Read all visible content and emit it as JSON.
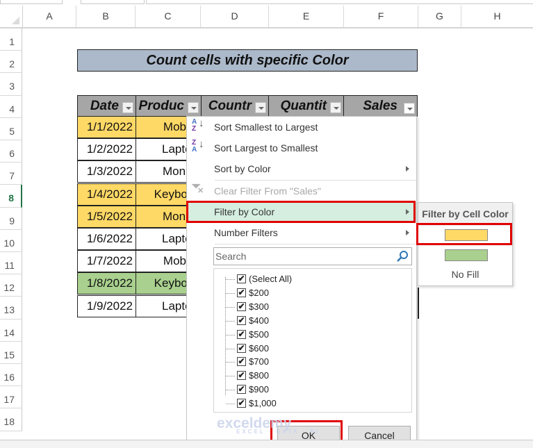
{
  "columns": [
    "A",
    "B",
    "C",
    "D",
    "E",
    "F",
    "G",
    "H"
  ],
  "rows": [
    "1",
    "2",
    "3",
    "4",
    "5",
    "6",
    "7",
    "8",
    "9",
    "10",
    "11",
    "12",
    "13",
    "14",
    "15",
    "16",
    "17",
    "18"
  ],
  "selected_row": "8",
  "sheet_title": "Count cells with specific Color",
  "table": {
    "headers": [
      "Date",
      "Produc",
      "Countr",
      "Quantit",
      "Sales"
    ],
    "rows": [
      {
        "date": "1/1/2022",
        "product": "Mobile",
        "fill": "#ffd966"
      },
      {
        "date": "1/2/2022",
        "product": "Laptop",
        "fill": "#ffffff"
      },
      {
        "date": "1/3/2022",
        "product": "Monito",
        "fill": "#ffffff"
      },
      {
        "date": "1/4/2022",
        "product": "Keyboar",
        "fill": "#ffd966"
      },
      {
        "date": "1/5/2022",
        "product": "Monito",
        "fill": "#ffd966"
      },
      {
        "date": "1/6/2022",
        "product": "Laptop",
        "fill": "#ffffff"
      },
      {
        "date": "1/7/2022",
        "product": "Mobile",
        "fill": "#ffffff"
      },
      {
        "date": "1/8/2022",
        "product": "Keyboar",
        "fill": "#a9d08e"
      },
      {
        "date": "1/9/2022",
        "product": "Laptop",
        "fill": "#ffffff"
      }
    ]
  },
  "filter_menu": {
    "items": [
      {
        "label": "Sort Smallest to Largest",
        "icon": "sort-ascending-icon",
        "enabled": true
      },
      {
        "label": "Sort Largest to Smallest",
        "icon": "sort-descending-icon",
        "enabled": true
      },
      {
        "label": "Sort by Color",
        "submenu": true,
        "enabled": true
      },
      {
        "label": "Clear Filter From \"Sales\"",
        "icon": "clear-filter-icon",
        "enabled": false
      },
      {
        "label": "Filter by Color",
        "submenu": true,
        "enabled": true,
        "highlighted": true
      },
      {
        "label": "Number Filters",
        "submenu": true,
        "enabled": true
      }
    ],
    "search_placeholder": "Search",
    "values": [
      "(Select All)",
      "$200",
      "$300",
      "$400",
      "$500",
      "$600",
      "$700",
      "$800",
      "$900",
      "$1,000"
    ],
    "checked": true,
    "ok_label": "OK",
    "cancel_label": "Cancel"
  },
  "color_submenu": {
    "header": "Filter by Cell Color",
    "swatches": [
      "#ffd966",
      "#a9d08e"
    ],
    "no_fill_label": "No Fill"
  },
  "watermark": {
    "brand": "exceldemy",
    "tagline": "EXCEL · DATA · BI"
  },
  "highlight_color": "#e00000"
}
